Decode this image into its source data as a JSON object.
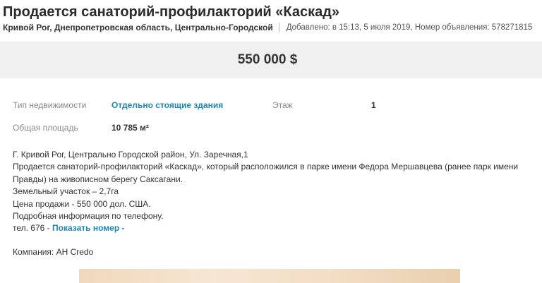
{
  "listing": {
    "title": "Продается санаторий-профилакторий «Каскад»",
    "location": "Кривой Рог, Днепропетровская область, Центрально-Городской",
    "meta": "Добавлено: в 15:13, 5 июля 2019, Номер объявления: 578271815",
    "price": "550 000 $"
  },
  "properties": {
    "type_label": "Тип недвижимости",
    "type_value": "Отдельно стоящие здания",
    "floor_label": "Этаж",
    "floor_value": "1",
    "area_label": "Общая площадь",
    "area_value": "10 785 м²"
  },
  "description": {
    "line1": "Г. Кривой Рог, Центрально Городской район, Ул. Заречная,1",
    "line2": "Продается санаторий-профилакторий «Каскад», который расположился в парке имени Федора Мершавцева (ранее парк имени",
    "line3": "Правды) на живописном берегу Саксагани.",
    "line4": "Земельный участок – 2,7га",
    "line5": "Цена продажи - 550 000 дол. США.",
    "line6": "Подробная информация по телефону.",
    "phone_prefix": "тел. 676 - ",
    "show_phone": "Показать номер -"
  },
  "company": "Компания: АН Credo"
}
